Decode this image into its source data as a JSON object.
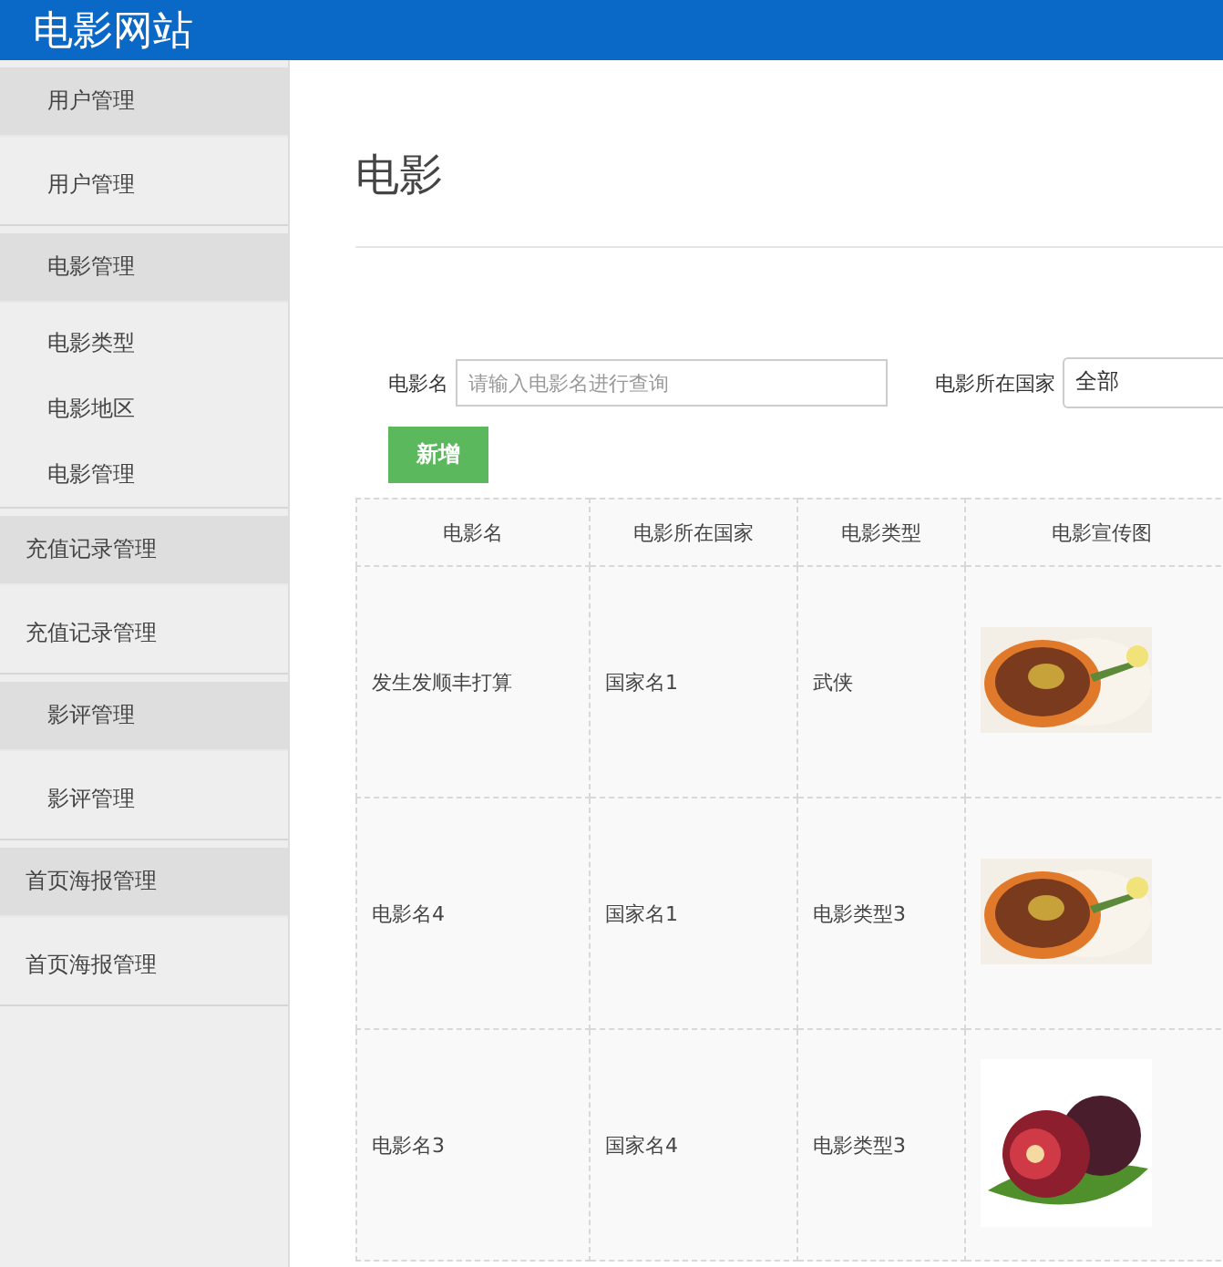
{
  "site_title": "电影网站",
  "sidebar": [
    {
      "title": "用户管理",
      "inset": true,
      "children": [
        "用户管理"
      ]
    },
    {
      "title": "电影管理",
      "inset": true,
      "children": [
        "电影类型",
        "电影地区",
        "电影管理"
      ]
    },
    {
      "title": "充值记录管理",
      "inset": false,
      "children": [
        "充值记录管理"
      ]
    },
    {
      "title": "影评管理",
      "inset": true,
      "children": [
        "影评管理"
      ]
    },
    {
      "title": "首页海报管理",
      "inset": false,
      "children": [
        "首页海报管理"
      ]
    }
  ],
  "page_title": "电影",
  "filters": [
    {
      "label": "电影名",
      "placeholder": "请输入电影名进行查询",
      "kind": "text"
    },
    {
      "label": "电影所在国家",
      "value": "全部",
      "kind": "select"
    }
  ],
  "add_button": "新增",
  "table": {
    "columns": [
      "电影名",
      "电影所在国家",
      "电影类型",
      "电影宣传图"
    ],
    "rows": [
      {
        "cells": [
          "发生发顺丰打算",
          "国家名1",
          "武侠"
        ],
        "picture": {
          "kind": "picture"
        }
      },
      {
        "cells": [
          "电影名4",
          "国家名1",
          "电影类型3"
        ],
        "picture": {
          "kind": "picture"
        }
      },
      {
        "cells": [
          "电影名3",
          "国家名4",
          "电影类型3"
        ],
        "picture": {
          "kind": "picture"
        }
      }
    ]
  }
}
